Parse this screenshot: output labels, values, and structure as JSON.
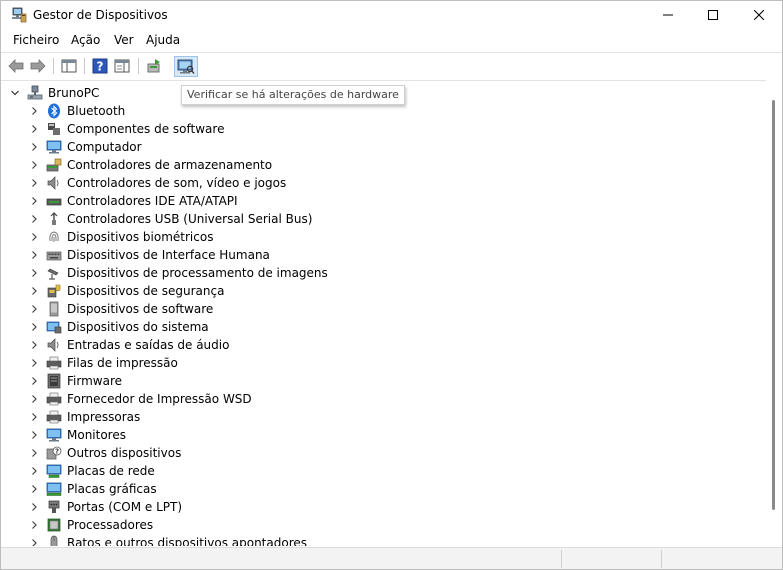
{
  "window": {
    "title": "Gestor de Dispositivos"
  },
  "menu": {
    "items": [
      "Ficheiro",
      "Ação",
      "Ver",
      "Ajuda"
    ]
  },
  "toolbar": {
    "tooltip": "Verificar se há alterações de hardware"
  },
  "tree": {
    "root_label": "BrunoPC",
    "items": [
      {
        "label": "Bluetooth",
        "icon": "bluetooth-icon"
      },
      {
        "label": "Componentes de software",
        "icon": "software-component-icon"
      },
      {
        "label": "Computador",
        "icon": "computer-icon"
      },
      {
        "label": "Controladores de armazenamento",
        "icon": "storage-controller-icon"
      },
      {
        "label": "Controladores de som, vídeo e jogos",
        "icon": "speaker-icon"
      },
      {
        "label": "Controladores IDE ATA/ATAPI",
        "icon": "ide-controller-icon"
      },
      {
        "label": "Controladores USB (Universal Serial Bus)",
        "icon": "usb-icon"
      },
      {
        "label": "Dispositivos biométricos",
        "icon": "fingerprint-icon"
      },
      {
        "label": "Dispositivos de Interface Humana",
        "icon": "hid-icon"
      },
      {
        "label": "Dispositivos de processamento de imagens",
        "icon": "camera-icon"
      },
      {
        "label": "Dispositivos de segurança",
        "icon": "security-device-icon"
      },
      {
        "label": "Dispositivos de software",
        "icon": "software-device-icon"
      },
      {
        "label": "Dispositivos do sistema",
        "icon": "system-device-icon"
      },
      {
        "label": "Entradas e saídas de áudio",
        "icon": "audio-io-icon"
      },
      {
        "label": "Filas de impressão",
        "icon": "print-queue-icon"
      },
      {
        "label": "Firmware",
        "icon": "firmware-icon"
      },
      {
        "label": "Fornecedor de Impressão WSD",
        "icon": "wsd-printer-icon"
      },
      {
        "label": "Impressoras",
        "icon": "printer-icon"
      },
      {
        "label": "Monitores",
        "icon": "monitor-icon"
      },
      {
        "label": "Outros dispositivos",
        "icon": "unknown-device-icon"
      },
      {
        "label": "Placas de rede",
        "icon": "network-adapter-icon"
      },
      {
        "label": "Placas gráficas",
        "icon": "display-adapter-icon"
      },
      {
        "label": "Portas (COM e LPT)",
        "icon": "port-icon"
      },
      {
        "label": "Processadores",
        "icon": "processor-icon"
      },
      {
        "label": "Ratos e outros dispositivos apontadores",
        "icon": "mouse-icon"
      }
    ]
  }
}
